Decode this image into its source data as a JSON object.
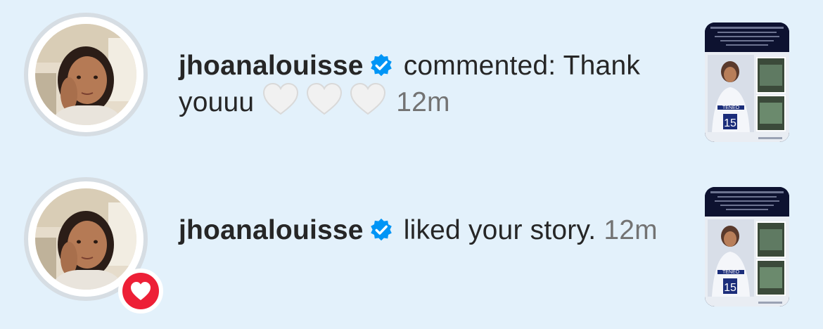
{
  "notifications": [
    {
      "username": "jhoanalouisse",
      "verified_icon": "verified-badge-icon",
      "action_text": "commented: Thank youuu",
      "hearts": [
        "white-heart-emoji",
        "white-heart-emoji",
        "white-heart-emoji"
      ],
      "time": "12m",
      "badge": null,
      "thumbnail_icon": "story-thumbnail"
    },
    {
      "username": "jhoanalouisse",
      "verified_icon": "verified-badge-icon",
      "action_text": "liked your story.",
      "hearts": [],
      "time": "12m",
      "badge": "heart-icon",
      "thumbnail_icon": "story-thumbnail"
    }
  ],
  "colors": {
    "background": "#e3f1fb",
    "verified_blue": "#0095f6",
    "like_red": "#ed1f36",
    "timestamp_gray": "#737373",
    "story_navy": "#0d1230"
  }
}
